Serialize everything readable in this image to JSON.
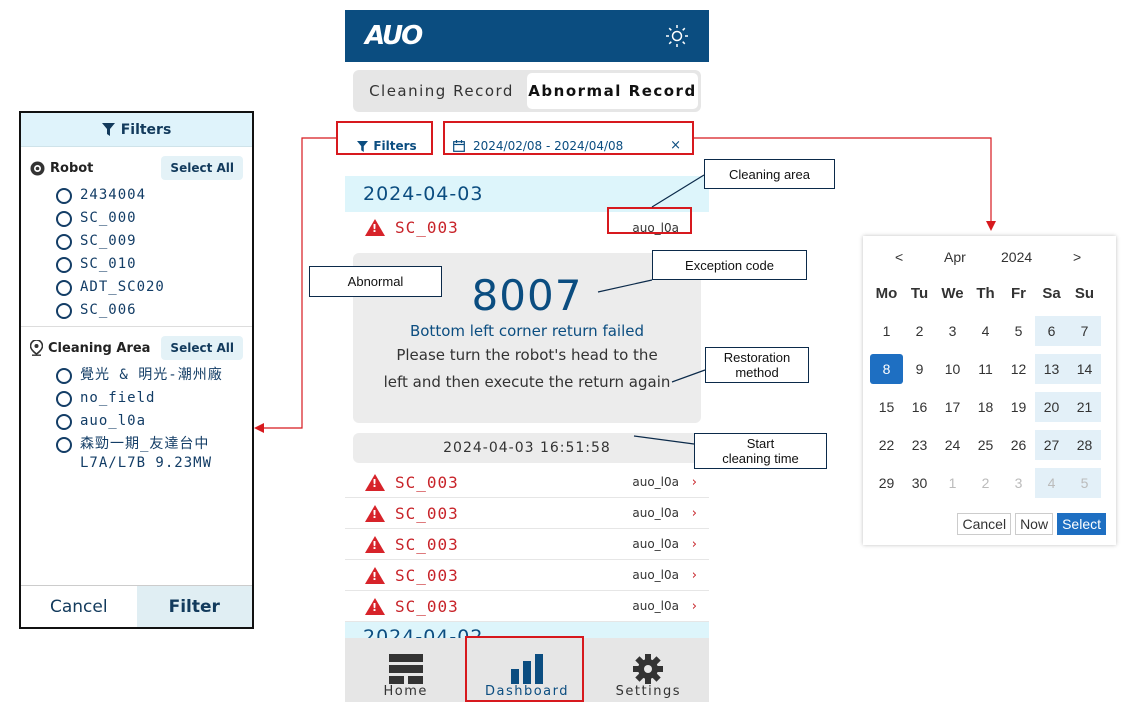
{
  "filter_panel": {
    "title": "Filters",
    "robot": {
      "title": "Robot",
      "select_all": "Select All",
      "items": [
        "2434004",
        "SC_000",
        "SC_009",
        "SC_010",
        "ADT_SC020",
        "SC_006"
      ]
    },
    "cleaning_area": {
      "title": "Cleaning Area",
      "select_all": "Select All",
      "items": [
        "覺光 & 明光-潮州廠",
        "no_field",
        "auo_l0a",
        "森勁一期_友達台中 L7A/L7B 9.23MW"
      ]
    },
    "cancel_label": "Cancel",
    "filter_label": "Filter"
  },
  "app": {
    "logo": "AUO",
    "tabs": [
      {
        "label": "Cleaning Record",
        "active": false
      },
      {
        "label": "Abnormal Record",
        "active": true
      }
    ],
    "filters_label": "Filters",
    "date_range": "2024/02/08 - 2024/04/08",
    "date_clear": "×",
    "group1_date": "2024-04-03",
    "first_record": {
      "name": "SC_003",
      "area": "auo_l0a"
    },
    "exception": {
      "code": "8007",
      "message": "Bottom left corner return failed",
      "method_line1": "Please turn the robot's head to the",
      "method_line2": "left and then execute the return again"
    },
    "start_time": "2024-04-03 16:51:58",
    "records": [
      {
        "name": "SC_003",
        "area": "auo_l0a"
      },
      {
        "name": "SC_003",
        "area": "auo_l0a"
      },
      {
        "name": "SC_003",
        "area": "auo_l0a"
      },
      {
        "name": "SC_003",
        "area": "auo_l0a"
      },
      {
        "name": "SC_003",
        "area": "auo_l0a"
      }
    ],
    "group2_date": "2024-04-02",
    "nav": [
      {
        "label": "Home"
      },
      {
        "label": "Dashboard"
      },
      {
        "label": "Settings"
      }
    ]
  },
  "callouts": {
    "cleaning_area": "Cleaning area",
    "exception_code": "Exception code",
    "abnormal": "Abnormal",
    "restoration_line1": "Restoration",
    "restoration_line2": "method",
    "start_line1": "Start",
    "start_line2": "cleaning time"
  },
  "calendar": {
    "prev": "<",
    "month": "Apr",
    "year": "2024",
    "next": ">",
    "weekdays": [
      "Mo",
      "Tu",
      "We",
      "Th",
      "Fr",
      "Sa",
      "Su"
    ],
    "weeks": [
      [
        "1",
        "2",
        "3",
        "4",
        "5",
        "6",
        "7"
      ],
      [
        "8",
        "9",
        "10",
        "11",
        "12",
        "13",
        "14"
      ],
      [
        "15",
        "16",
        "17",
        "18",
        "19",
        "20",
        "21"
      ],
      [
        "22",
        "23",
        "24",
        "25",
        "26",
        "27",
        "28"
      ],
      [
        "29",
        "30",
        "1",
        "2",
        "3",
        "4",
        "5"
      ]
    ],
    "selected_day": "8",
    "cancel": "Cancel",
    "now": "Now",
    "select": "Select"
  },
  "colors": {
    "brand": "#0b4d80",
    "alert": "#c8242a",
    "annotation": "#d7191e",
    "selected": "#1e6fc2"
  }
}
